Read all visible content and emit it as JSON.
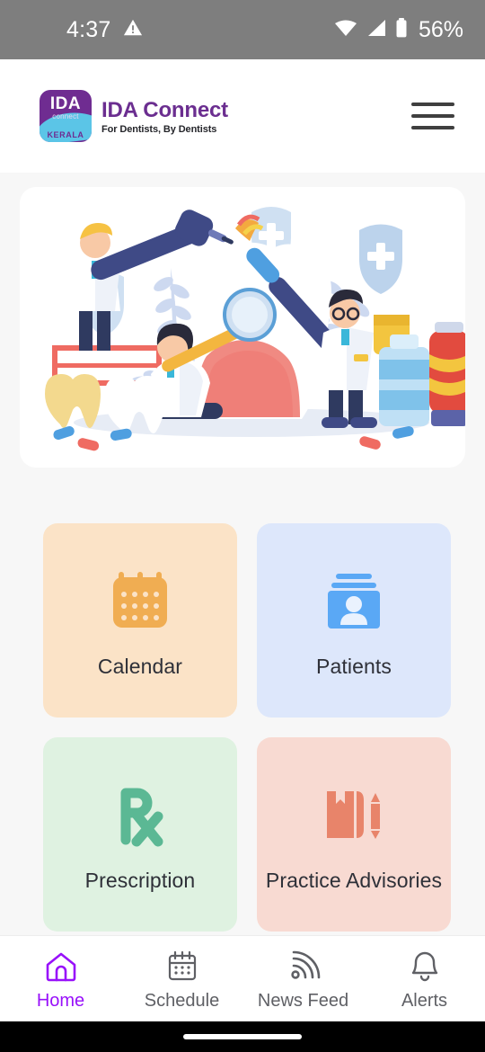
{
  "status_bar": {
    "time": "4:37",
    "warning_icon": "warning-triangle-icon",
    "wifi_icon": "wifi-icon",
    "signal_icon": "cellular-signal-icon",
    "battery_icon": "battery-icon",
    "battery_percent": "56%",
    "background": "#7e7e7e"
  },
  "header": {
    "logo": {
      "primary": "IDA",
      "secondary": "connect",
      "region": "KERALA",
      "purple": "#6f2c91",
      "blue": "#5bc5e7"
    },
    "title": "IDA Connect",
    "subtitle": "For Dentists, By Dentists",
    "menu_label": "menu"
  },
  "hero": {
    "alt": "dental-team-illustration"
  },
  "tiles": [
    {
      "label": "Calendar",
      "icon": "calendar-icon",
      "bg": "#fbe3c7",
      "fg": "#f0ad52"
    },
    {
      "label": "Patients",
      "icon": "patients-folder-icon",
      "bg": "#dde7fb",
      "fg": "#5aa8f5"
    },
    {
      "label": "Prescription",
      "icon": "rx-icon",
      "bg": "#dff2e1",
      "fg": "#5bb894"
    },
    {
      "label": "Practice Advisories",
      "icon": "book-pencil-icon",
      "bg": "#f8dad2",
      "fg": "#e8846a"
    }
  ],
  "tiles_partial": [
    {
      "bg": "#aed4ee"
    },
    {
      "bg": "#d0d0d0"
    }
  ],
  "bottom_nav": {
    "active_color": "#9810fa",
    "inactive_color": "#5f6065",
    "items": [
      {
        "label": "Home",
        "icon": "home-icon",
        "active": true
      },
      {
        "label": "Schedule",
        "icon": "calendar-outline-icon",
        "active": false
      },
      {
        "label": "News Feed",
        "icon": "rss-icon",
        "active": false
      },
      {
        "label": "Alerts",
        "icon": "bell-icon",
        "active": false
      }
    ]
  }
}
